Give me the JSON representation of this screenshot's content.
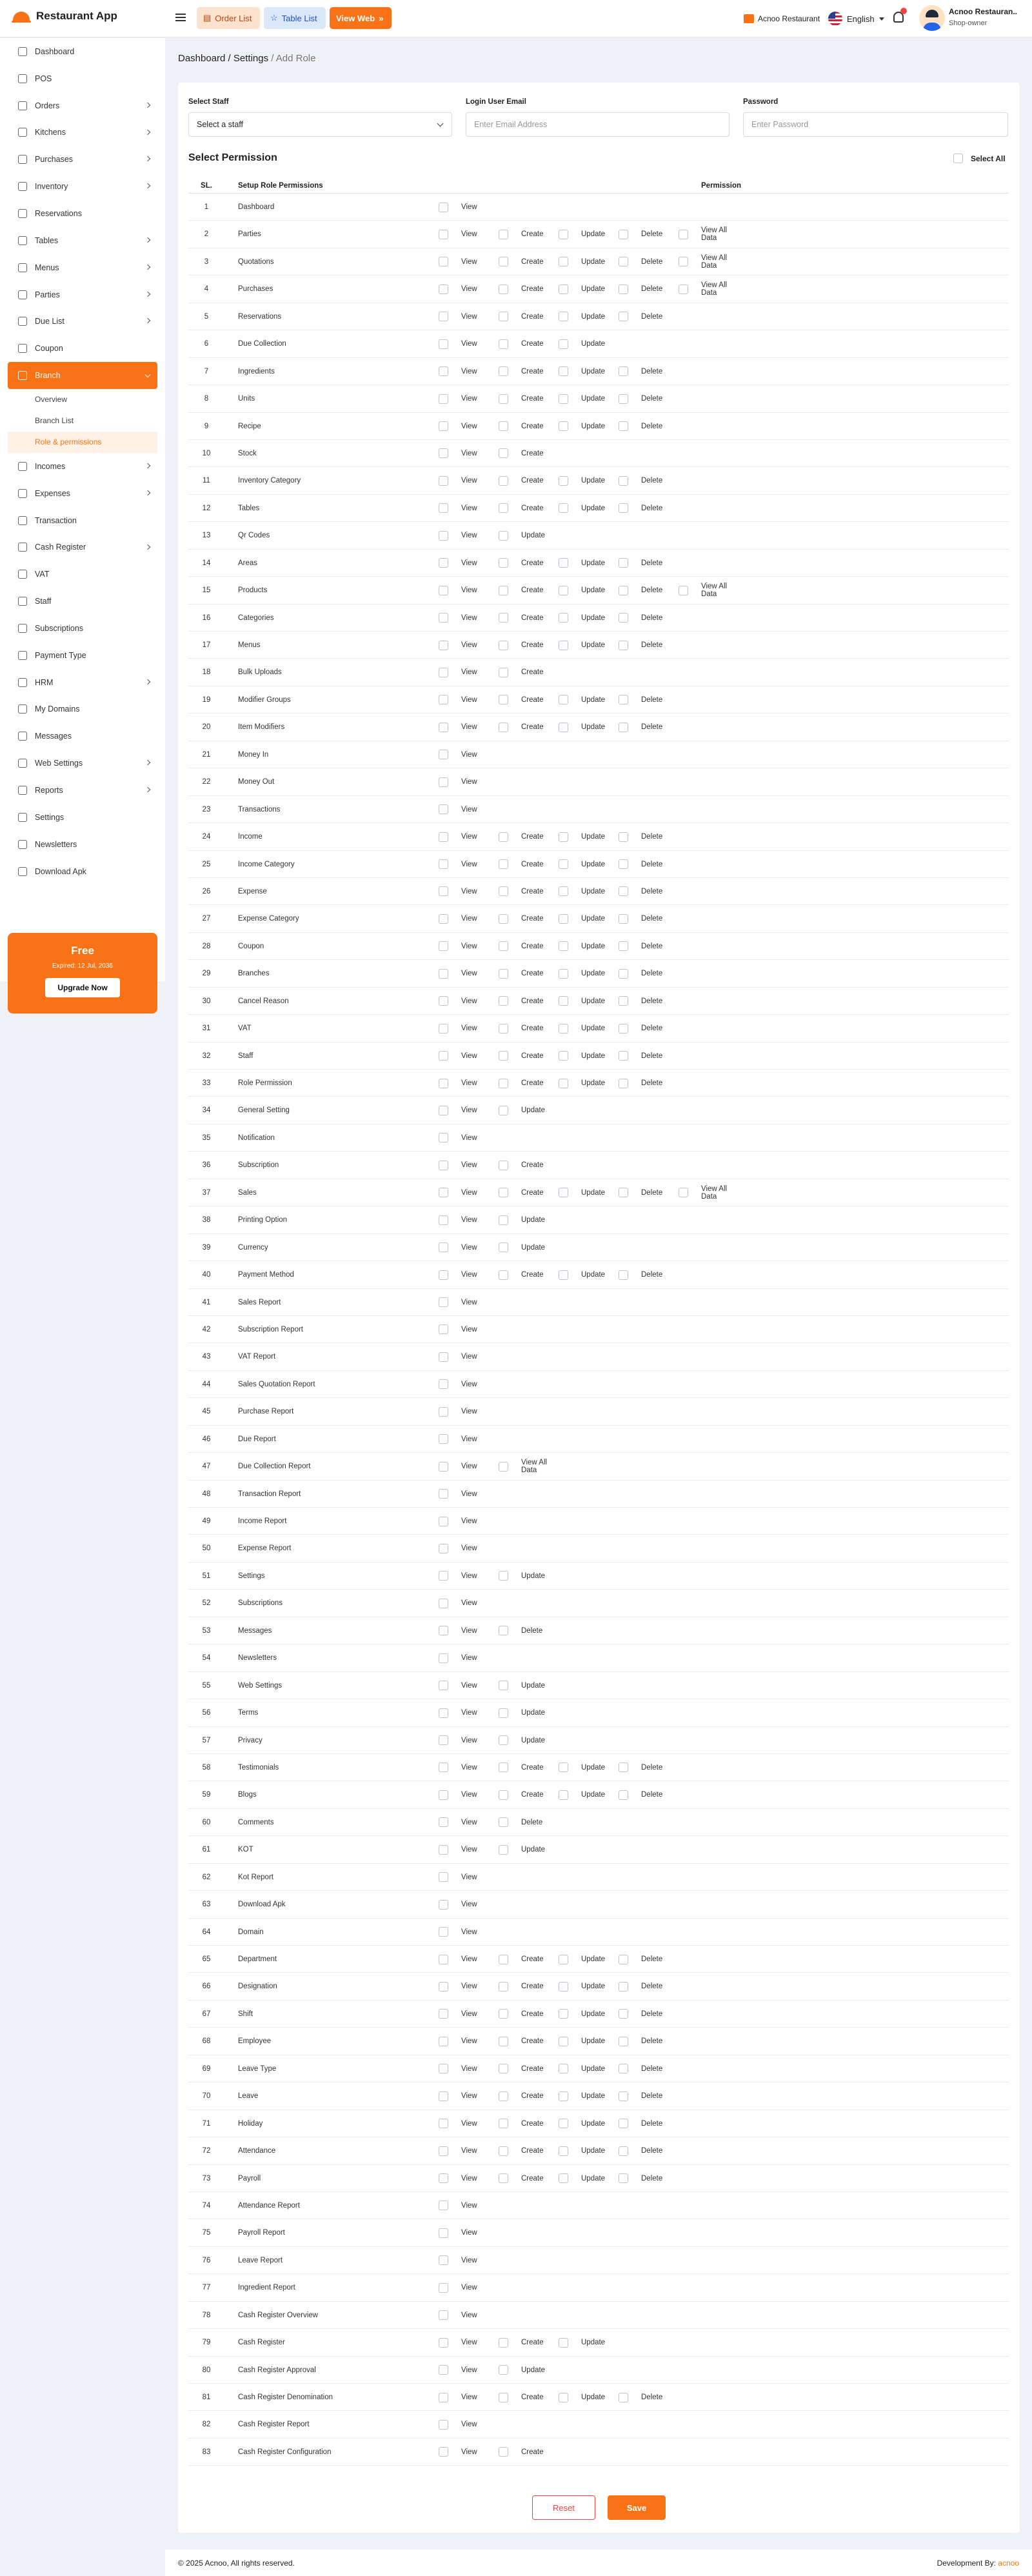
{
  "app": {
    "name": "Restaurant App"
  },
  "topbar": {
    "order_list": "Order List",
    "table_list": "Table List",
    "view_web": "View Web",
    "restaurant": "Acnoo Restaurant",
    "language": "English",
    "notifications": "1",
    "user_name": "Acnoo Restauran..",
    "user_role": "Shop-owner"
  },
  "sidebar": {
    "items": [
      {
        "label": "Dashboard",
        "icon": "home-icon",
        "chevron": false
      },
      {
        "label": "POS",
        "icon": "pos-icon",
        "chevron": false
      },
      {
        "label": "Orders",
        "icon": "orders-icon",
        "chevron": true
      },
      {
        "label": "Kitchens",
        "icon": "kitchen-icon",
        "chevron": true
      },
      {
        "label": "Purchases",
        "icon": "cart-icon",
        "chevron": true
      },
      {
        "label": "Inventory",
        "icon": "inventory-icon",
        "chevron": true
      },
      {
        "label": "Reservations",
        "icon": "calendar-icon",
        "chevron": false
      },
      {
        "label": "Tables",
        "icon": "table-icon",
        "chevron": true
      },
      {
        "label": "Menus",
        "icon": "menu-icon",
        "chevron": true
      },
      {
        "label": "Parties",
        "icon": "users-icon",
        "chevron": true
      },
      {
        "label": "Due List",
        "icon": "due-icon",
        "chevron": true
      },
      {
        "label": "Coupon",
        "icon": "coupon-icon",
        "chevron": false
      },
      {
        "label": "Branch",
        "icon": "branch-icon",
        "chevron": true,
        "active": true,
        "children": [
          "Overview",
          "Branch List",
          "Role & permissions"
        ]
      },
      {
        "label": "Incomes",
        "icon": "income-icon",
        "chevron": true
      },
      {
        "label": "Expenses",
        "icon": "expense-icon",
        "chevron": true
      },
      {
        "label": "Transaction",
        "icon": "transaction-icon",
        "chevron": false
      },
      {
        "label": "Cash Register",
        "icon": "cash-register-icon",
        "chevron": true
      },
      {
        "label": "VAT",
        "icon": "vat-icon",
        "chevron": false
      },
      {
        "label": "Staff",
        "icon": "staff-icon",
        "chevron": false
      },
      {
        "label": "Subscriptions",
        "icon": "subscription-icon",
        "chevron": false
      },
      {
        "label": "Payment Type",
        "icon": "payment-icon",
        "chevron": false
      },
      {
        "label": "HRM",
        "icon": "hrm-icon",
        "chevron": true
      },
      {
        "label": "My Domains",
        "icon": "globe-icon",
        "chevron": false
      },
      {
        "label": "Messages",
        "icon": "message-icon",
        "chevron": false
      },
      {
        "label": "Web Settings",
        "icon": "web-settings-icon",
        "chevron": true
      },
      {
        "label": "Reports",
        "icon": "report-icon",
        "chevron": true
      },
      {
        "label": "Settings",
        "icon": "gear-icon",
        "chevron": false
      },
      {
        "label": "Newsletters",
        "icon": "send-icon",
        "chevron": false
      },
      {
        "label": "Download Apk",
        "icon": "download-icon",
        "chevron": false
      }
    ]
  },
  "promo": {
    "title": "Free",
    "expired": "Expired: 12 Jul, 2036",
    "button": "Upgrade Now"
  },
  "breadcrumb": {
    "path": "Dashboard / Settings",
    "current": " / Add Role"
  },
  "form": {
    "staff_label": "Select Staff",
    "staff_value": "Select a staff",
    "email_label": "Login User Email",
    "email_placeholder": "Enter Email Address",
    "password_label": "Password",
    "password_placeholder": "Enter Password"
  },
  "permissions": {
    "title": "Select Permission",
    "select_all": "Select All",
    "col_sl": "SL.",
    "col_name": "Setup Role Permissions",
    "col_perm": "Permission",
    "rows": [
      {
        "sl": "1",
        "name": "Dashboard",
        "opts": [
          "View"
        ]
      },
      {
        "sl": "2",
        "name": "Parties",
        "opts": [
          "View",
          "Create",
          "Update",
          "Delete",
          "View All Data"
        ]
      },
      {
        "sl": "3",
        "name": "Quotations",
        "opts": [
          "View",
          "Create",
          "Update",
          "Delete",
          "View All Data"
        ]
      },
      {
        "sl": "4",
        "name": "Purchases",
        "opts": [
          "View",
          "Create",
          "Update",
          "Delete",
          "View All Data"
        ]
      },
      {
        "sl": "5",
        "name": "Reservations",
        "opts": [
          "View",
          "Create",
          "Update",
          "Delete"
        ]
      },
      {
        "sl": "6",
        "name": "Due Collection",
        "opts": [
          "View",
          "Create",
          "Update"
        ]
      },
      {
        "sl": "7",
        "name": "Ingredients",
        "opts": [
          "View",
          "Create",
          "Update",
          "Delete"
        ]
      },
      {
        "sl": "8",
        "name": "Units",
        "opts": [
          "View",
          "Create",
          "Update",
          "Delete"
        ]
      },
      {
        "sl": "9",
        "name": "Recipe",
        "opts": [
          "View",
          "Create",
          "Update",
          "Delete"
        ]
      },
      {
        "sl": "10",
        "name": "Stock",
        "opts": [
          "View",
          "Create"
        ]
      },
      {
        "sl": "11",
        "name": "Inventory Category",
        "opts": [
          "View",
          "Create",
          "Update",
          "Delete"
        ]
      },
      {
        "sl": "12",
        "name": "Tables",
        "opts": [
          "View",
          "Create",
          "Update",
          "Delete"
        ]
      },
      {
        "sl": "13",
        "name": "Qr Codes",
        "opts": [
          "View",
          "Update"
        ]
      },
      {
        "sl": "14",
        "name": "Areas",
        "opts": [
          "View",
          "Create",
          "Update",
          "Delete"
        ]
      },
      {
        "sl": "15",
        "name": "Products",
        "opts": [
          "View",
          "Create",
          "Update",
          "Delete",
          "View All Data"
        ]
      },
      {
        "sl": "16",
        "name": "Categories",
        "opts": [
          "View",
          "Create",
          "Update",
          "Delete"
        ]
      },
      {
        "sl": "17",
        "name": "Menus",
        "opts": [
          "View",
          "Create",
          "Update",
          "Delete"
        ]
      },
      {
        "sl": "18",
        "name": "Bulk Uploads",
        "opts": [
          "View",
          "Create"
        ]
      },
      {
        "sl": "19",
        "name": "Modifier Groups",
        "opts": [
          "View",
          "Create",
          "Update",
          "Delete"
        ]
      },
      {
        "sl": "20",
        "name": "Item Modifiers",
        "opts": [
          "View",
          "Create",
          "Update",
          "Delete"
        ]
      },
      {
        "sl": "21",
        "name": "Money In",
        "opts": [
          "View"
        ]
      },
      {
        "sl": "22",
        "name": "Money Out",
        "opts": [
          "View"
        ]
      },
      {
        "sl": "23",
        "name": "Transactions",
        "opts": [
          "View"
        ]
      },
      {
        "sl": "24",
        "name": "Income",
        "opts": [
          "View",
          "Create",
          "Update",
          "Delete"
        ]
      },
      {
        "sl": "25",
        "name": "Income Category",
        "opts": [
          "View",
          "Create",
          "Update",
          "Delete"
        ]
      },
      {
        "sl": "26",
        "name": "Expense",
        "opts": [
          "View",
          "Create",
          "Update",
          "Delete"
        ]
      },
      {
        "sl": "27",
        "name": "Expense Category",
        "opts": [
          "View",
          "Create",
          "Update",
          "Delete"
        ]
      },
      {
        "sl": "28",
        "name": "Coupon",
        "opts": [
          "View",
          "Create",
          "Update",
          "Delete"
        ]
      },
      {
        "sl": "29",
        "name": "Branches",
        "opts": [
          "View",
          "Create",
          "Update",
          "Delete"
        ]
      },
      {
        "sl": "30",
        "name": "Cancel Reason",
        "opts": [
          "View",
          "Create",
          "Update",
          "Delete"
        ]
      },
      {
        "sl": "31",
        "name": "VAT",
        "opts": [
          "View",
          "Create",
          "Update",
          "Delete"
        ]
      },
      {
        "sl": "32",
        "name": "Staff",
        "opts": [
          "View",
          "Create",
          "Update",
          "Delete"
        ]
      },
      {
        "sl": "33",
        "name": "Role Permission",
        "opts": [
          "View",
          "Create",
          "Update",
          "Delete"
        ]
      },
      {
        "sl": "34",
        "name": "General Setting",
        "opts": [
          "View",
          "Update"
        ]
      },
      {
        "sl": "35",
        "name": "Notification",
        "opts": [
          "View"
        ]
      },
      {
        "sl": "36",
        "name": "Subscription",
        "opts": [
          "View",
          "Create"
        ]
      },
      {
        "sl": "37",
        "name": "Sales",
        "opts": [
          "View",
          "Create",
          "Update",
          "Delete",
          "View All Data"
        ]
      },
      {
        "sl": "38",
        "name": "Printing Option",
        "opts": [
          "View",
          "Update"
        ]
      },
      {
        "sl": "39",
        "name": "Currency",
        "opts": [
          "View",
          "Update"
        ]
      },
      {
        "sl": "40",
        "name": "Payment Method",
        "opts": [
          "View",
          "Create",
          "Update",
          "Delete"
        ]
      },
      {
        "sl": "41",
        "name": "Sales Report",
        "opts": [
          "View"
        ]
      },
      {
        "sl": "42",
        "name": "Subscription Report",
        "opts": [
          "View"
        ]
      },
      {
        "sl": "43",
        "name": "VAT Report",
        "opts": [
          "View"
        ]
      },
      {
        "sl": "44",
        "name": "Sales Quotation Report",
        "opts": [
          "View"
        ]
      },
      {
        "sl": "45",
        "name": "Purchase Report",
        "opts": [
          "View"
        ]
      },
      {
        "sl": "46",
        "name": "Due Report",
        "opts": [
          "View"
        ]
      },
      {
        "sl": "47",
        "name": "Due Collection Report",
        "opts": [
          "View",
          "View All Data"
        ]
      },
      {
        "sl": "48",
        "name": "Transaction Report",
        "opts": [
          "View"
        ]
      },
      {
        "sl": "49",
        "name": "Income Report",
        "opts": [
          "View"
        ]
      },
      {
        "sl": "50",
        "name": "Expense Report",
        "opts": [
          "View"
        ]
      },
      {
        "sl": "51",
        "name": "Settings",
        "opts": [
          "View",
          "Update"
        ]
      },
      {
        "sl": "52",
        "name": "Subscriptions",
        "opts": [
          "View"
        ]
      },
      {
        "sl": "53",
        "name": "Messages",
        "opts": [
          "View",
          "Delete"
        ]
      },
      {
        "sl": "54",
        "name": "Newsletters",
        "opts": [
          "View"
        ]
      },
      {
        "sl": "55",
        "name": "Web Settings",
        "opts": [
          "View",
          "Update"
        ]
      },
      {
        "sl": "56",
        "name": "Terms",
        "opts": [
          "View",
          "Update"
        ]
      },
      {
        "sl": "57",
        "name": "Privacy",
        "opts": [
          "View",
          "Update"
        ]
      },
      {
        "sl": "58",
        "name": "Testimonials",
        "opts": [
          "View",
          "Create",
          "Update",
          "Delete"
        ]
      },
      {
        "sl": "59",
        "name": "Blogs",
        "opts": [
          "View",
          "Create",
          "Update",
          "Delete"
        ]
      },
      {
        "sl": "60",
        "name": "Comments",
        "opts": [
          "View",
          "Delete"
        ]
      },
      {
        "sl": "61",
        "name": "KOT",
        "opts": [
          "View",
          "Update"
        ]
      },
      {
        "sl": "62",
        "name": "Kot Report",
        "opts": [
          "View"
        ]
      },
      {
        "sl": "63",
        "name": "Download Apk",
        "opts": [
          "View"
        ]
      },
      {
        "sl": "64",
        "name": "Domain",
        "opts": [
          "View"
        ]
      },
      {
        "sl": "65",
        "name": "Department",
        "opts": [
          "View",
          "Create",
          "Update",
          "Delete"
        ]
      },
      {
        "sl": "66",
        "name": "Designation",
        "opts": [
          "View",
          "Create",
          "Update",
          "Delete"
        ]
      },
      {
        "sl": "67",
        "name": "Shift",
        "opts": [
          "View",
          "Create",
          "Update",
          "Delete"
        ]
      },
      {
        "sl": "68",
        "name": "Employee",
        "opts": [
          "View",
          "Create",
          "Update",
          "Delete"
        ]
      },
      {
        "sl": "69",
        "name": "Leave Type",
        "opts": [
          "View",
          "Create",
          "Update",
          "Delete"
        ]
      },
      {
        "sl": "70",
        "name": "Leave",
        "opts": [
          "View",
          "Create",
          "Update",
          "Delete"
        ]
      },
      {
        "sl": "71",
        "name": "Holiday",
        "opts": [
          "View",
          "Create",
          "Update",
          "Delete"
        ]
      },
      {
        "sl": "72",
        "name": "Attendance",
        "opts": [
          "View",
          "Create",
          "Update",
          "Delete"
        ]
      },
      {
        "sl": "73",
        "name": "Payroll",
        "opts": [
          "View",
          "Create",
          "Update",
          "Delete"
        ]
      },
      {
        "sl": "74",
        "name": "Attendance Report",
        "opts": [
          "View"
        ]
      },
      {
        "sl": "75",
        "name": "Payroll Report",
        "opts": [
          "View"
        ]
      },
      {
        "sl": "76",
        "name": "Leave Report",
        "opts": [
          "View"
        ]
      },
      {
        "sl": "77",
        "name": "Ingredient Report",
        "opts": [
          "View"
        ]
      },
      {
        "sl": "78",
        "name": "Cash Register Overview",
        "opts": [
          "View"
        ]
      },
      {
        "sl": "79",
        "name": "Cash Register",
        "opts": [
          "View",
          "Create",
          "Update"
        ]
      },
      {
        "sl": "80",
        "name": "Cash Register Approval",
        "opts": [
          "View",
          "Update"
        ]
      },
      {
        "sl": "81",
        "name": "Cash Register Denomination",
        "opts": [
          "View",
          "Create",
          "Update",
          "Delete"
        ]
      },
      {
        "sl": "82",
        "name": "Cash Register Report",
        "opts": [
          "View"
        ]
      },
      {
        "sl": "83",
        "name": "Cash Register Configuration",
        "opts": [
          "View",
          "Create"
        ]
      }
    ]
  },
  "actions": {
    "reset": "Reset",
    "save": "Save"
  },
  "footer": {
    "copyright": "© 2025 Acnoo, All rights reserved.",
    "dev_prefix": "Development By: ",
    "dev_name": "acnoo"
  },
  "colors": {
    "accent": "#F97316",
    "danger": "#EF4444"
  }
}
